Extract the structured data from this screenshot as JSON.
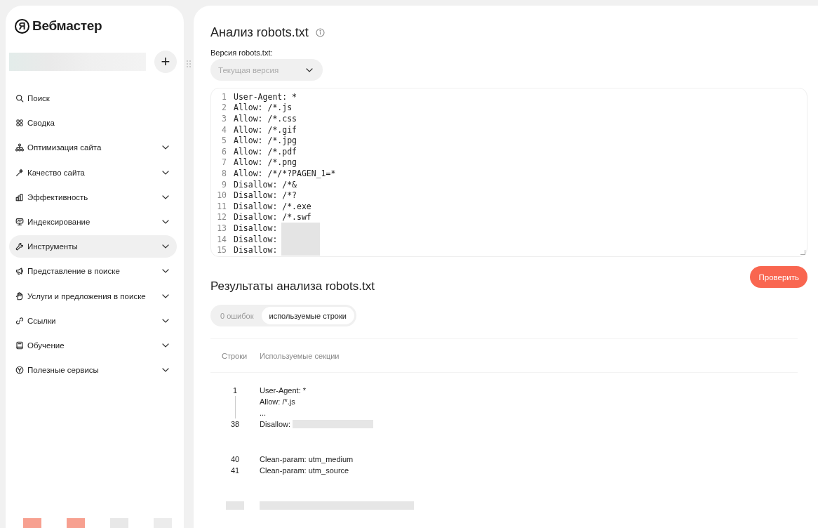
{
  "sidebar": {
    "logo": {
      "mark": "Я",
      "text": "Вебмастер"
    },
    "site_selector": {
      "obscured": true,
      "add": "+"
    },
    "items": [
      {
        "kind": "search",
        "label": "Поиск",
        "expandable": false,
        "selected": false
      },
      {
        "kind": "summary",
        "label": "Сводка",
        "expandable": false,
        "selected": false
      },
      {
        "kind": "tree",
        "label": "Оптимизация сайта",
        "expandable": true,
        "selected": false
      },
      {
        "kind": "sparkle",
        "label": "Качество сайта",
        "expandable": true,
        "selected": false
      },
      {
        "kind": "bars",
        "label": "Эффективность",
        "expandable": true,
        "selected": false
      },
      {
        "kind": "monitor",
        "label": "Индексирование",
        "expandable": true,
        "selected": false
      },
      {
        "kind": "wrench",
        "label": "Инструменты",
        "expandable": true,
        "selected": true
      },
      {
        "kind": "megaphone",
        "label": "Представление в поиске",
        "expandable": true,
        "selected": false
      },
      {
        "kind": "hand",
        "label": "Услуги и предложения в поиске",
        "expandable": true,
        "selected": false
      },
      {
        "kind": "link",
        "label": "Ссылки",
        "expandable": true,
        "selected": false
      },
      {
        "kind": "book",
        "label": "Обучение",
        "expandable": true,
        "selected": false
      },
      {
        "kind": "badge",
        "label": "Полезные сервисы",
        "expandable": true,
        "selected": false
      }
    ],
    "footer": [
      {
        "color": "#f7a090"
      },
      {
        "color": "#f7a090"
      },
      {
        "color": "#e8e8e8"
      },
      {
        "color": "#ececec"
      }
    ]
  },
  "main": {
    "title": "Анализ robots.txt",
    "version_label": "Версия robots.txt:",
    "version_select": {
      "value": "Текущая версия",
      "disabled": true
    },
    "editor_lines": [
      {
        "number": "1",
        "text": "User-Agent: *",
        "obscured": false
      },
      {
        "number": "2",
        "text": "Allow: /*.js",
        "obscured": false
      },
      {
        "number": "3",
        "text": "Allow: /*.css",
        "obscured": false
      },
      {
        "number": "4",
        "text": "Allow: /*.gif",
        "obscured": false
      },
      {
        "number": "5",
        "text": "Allow: /*.jpg",
        "obscured": false
      },
      {
        "number": "6",
        "text": "Allow: /*.pdf",
        "obscured": false
      },
      {
        "number": "7",
        "text": "Allow: /*.png",
        "obscured": false
      },
      {
        "number": "8",
        "text": "Allow: /*/*?PAGEN_1=*",
        "obscured": false
      },
      {
        "number": "9",
        "text": "Disallow: /*&",
        "obscured": false
      },
      {
        "number": "10",
        "text": "Disallow: /*?",
        "obscured": false
      },
      {
        "number": "11",
        "text": "Disallow: /*.exe",
        "obscured": false
      },
      {
        "number": "12",
        "text": "Disallow: /*.swf",
        "obscured": false
      },
      {
        "number": "13",
        "text": "Disallow:",
        "obscured": true
      },
      {
        "number": "14",
        "text": "Disallow:",
        "obscured": true
      },
      {
        "number": "15",
        "text": "Disallow:",
        "obscured": true
      }
    ],
    "check_button": "Проверить",
    "results_title": "Результаты анализа robots.txt",
    "result_tabs": [
      {
        "label": "0 ошибок",
        "selected": false
      },
      {
        "label": "используемые строки",
        "selected": true
      }
    ],
    "table": {
      "columns": [
        "Строки",
        "Используемые секции"
      ],
      "groups": [
        {
          "lines": [
            {
              "number": "1",
              "text": "User-Agent: *",
              "obscured": false
            },
            {
              "text": "Allow: /*.js",
              "obscured": false
            },
            {
              "text": "...",
              "obscured": false
            },
            {
              "number": "38",
              "text": "Disallow:",
              "obscured": true
            }
          ],
          "range": true
        },
        {
          "lines": [
            {
              "number": "40",
              "text": "Clean-param: utm_medium",
              "obscured": false
            },
            {
              "number": "41",
              "text": "Clean-param: utm_source",
              "obscured": false
            }
          ]
        },
        {
          "lines": [
            {
              "obscured": true
            }
          ]
        }
      ]
    }
  }
}
